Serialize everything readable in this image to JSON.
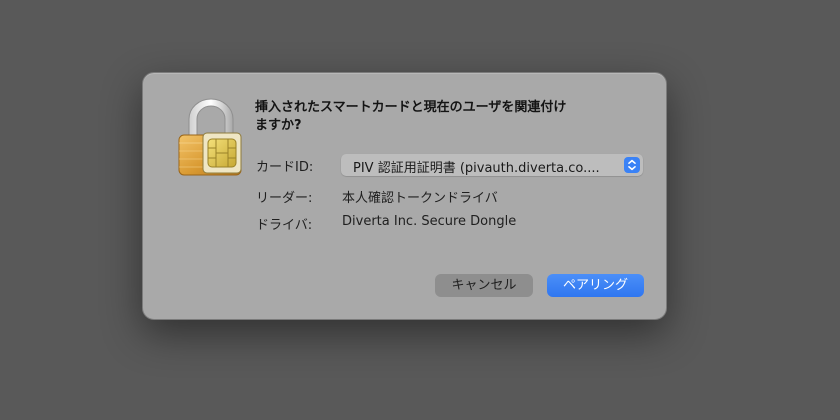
{
  "dialog": {
    "title_line1": "挿入されたスマートカードと現在のユーザを関連付け",
    "title_line2": "ますか?",
    "icon": "padlock-smartcard-icon",
    "fields": {
      "card_id_label": "カードID:",
      "card_id_value": "PIV 認証用証明書 (pivauth.diverta.co....",
      "reader_label": "リーダー:",
      "reader_value": "本人確認トークンドライバ",
      "driver_label": "ドライバ:",
      "driver_value": "Diverta Inc. Secure Dongle"
    },
    "buttons": {
      "cancel_label": "キャンセル",
      "pair_label": "ペアリング"
    }
  },
  "colors": {
    "accent": "#3b82f6",
    "dialog_bg": "#a9a9a9",
    "backdrop": "#595959"
  }
}
